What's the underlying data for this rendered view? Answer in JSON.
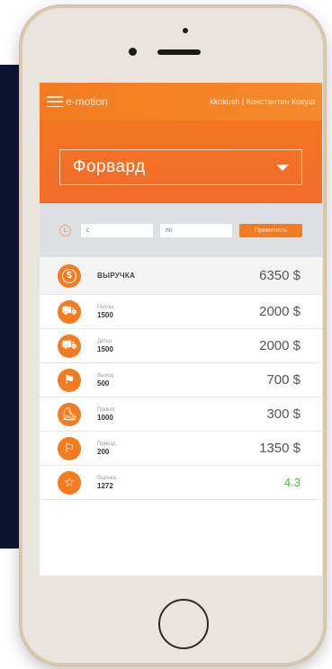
{
  "app": {
    "brand": "e-motion",
    "user": "kkokush | Константин Кокуш"
  },
  "hero": {
    "selected": "Форвард"
  },
  "filter": {
    "from_placeholder": "с",
    "to_placeholder": "по",
    "apply_label": "Применить"
  },
  "revenue": {
    "title": "ВЫРУЧКА",
    "value": "6350 $"
  },
  "rows": [
    {
      "icon": "ride-icon",
      "label": "Роллы",
      "count": "1500",
      "value": "2000 $"
    },
    {
      "icon": "ride-icon",
      "label": "Детки",
      "count": "1500",
      "value": "2000 $"
    },
    {
      "icon": "flag-icon",
      "label": "Выход",
      "count": "500",
      "value": "700 $"
    },
    {
      "icon": "scooter-icon",
      "label": "Прокат",
      "count": "1000",
      "value": "300 $"
    },
    {
      "icon": "race-flags-icon",
      "label": "Приезд",
      "count": "200",
      "value": "1350 $"
    },
    {
      "icon": "star-icon",
      "label": "Оценка",
      "count": "1272",
      "value": "4.3"
    }
  ],
  "colors": {
    "accent": "#f47b20",
    "rating": "#57b04a"
  }
}
